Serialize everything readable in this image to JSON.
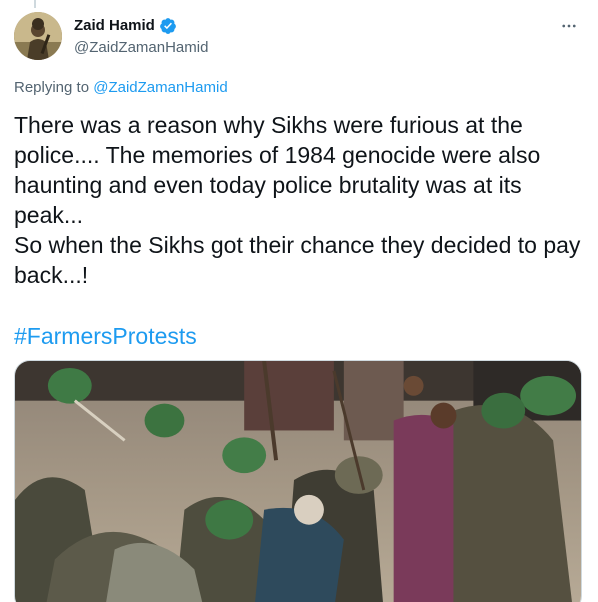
{
  "tweet": {
    "author": {
      "display_name": "Zaid Hamid",
      "handle": "@ZaidZamanHamid",
      "verified": true,
      "avatar_icon": "profile-photo-icon"
    },
    "more_icon": "more-options-icon",
    "replying_prefix": "Replying to",
    "replying_to": "@ZaidZamanHamid",
    "text_lines": [
      "There was a reason why Sikhs were furious at the",
      "police.... The memories of 1984 genocide were also",
      "haunting and even today police brutality was at its",
      "peak...",
      "So when the Sikhs got their chance they decided to pay",
      "back...!"
    ],
    "hashtag": "#FarmersProtests",
    "media_icon": "video-thumbnail-icon"
  },
  "colors": {
    "text": "#0f1419",
    "secondary": "#536471",
    "link": "#1d9bf0",
    "verified": "#1d9bf0"
  }
}
